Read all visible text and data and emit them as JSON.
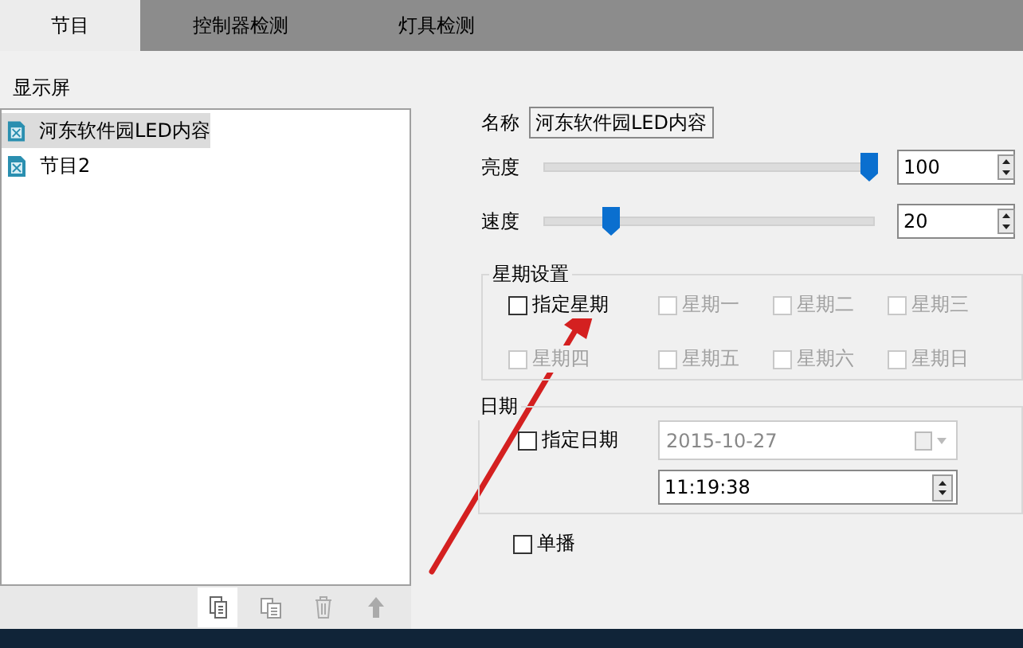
{
  "tabs": [
    {
      "label": "节目",
      "selected": true
    },
    {
      "label": "控制器检测",
      "selected": false
    },
    {
      "label": "灯具检测",
      "selected": false
    }
  ],
  "panel_label": "显示屏",
  "programs": [
    {
      "label": "河东软件园LED内容",
      "selected": true
    },
    {
      "label": "节目2",
      "selected": false
    }
  ],
  "toolbar": [
    {
      "kind": "copy",
      "disabled": false
    },
    {
      "kind": "duplicate",
      "disabled": true
    },
    {
      "kind": "delete",
      "disabled": true
    },
    {
      "kind": "up",
      "disabled": true
    }
  ],
  "name": {
    "label": "名称",
    "value": "河东软件园LED内容"
  },
  "sliders": [
    {
      "label": "亮度",
      "level": 0.98,
      "value": "100"
    },
    {
      "label": "速度",
      "level": 0.2,
      "value": "20"
    }
  ],
  "weekday_group": {
    "title": "星期设置",
    "specify": {
      "label": "指定星期",
      "checked": false
    },
    "days": [
      {
        "label": "星期一",
        "checked": false,
        "disabled": true
      },
      {
        "label": "星期二",
        "checked": false,
        "disabled": true
      },
      {
        "label": "星期三",
        "checked": false,
        "disabled": true
      },
      {
        "label": "星期四",
        "checked": false,
        "disabled": true
      },
      {
        "label": "星期五",
        "checked": false,
        "disabled": true
      },
      {
        "label": "星期六",
        "checked": false,
        "disabled": true
      },
      {
        "label": "星期日",
        "checked": false,
        "disabled": true
      }
    ]
  },
  "date_group": {
    "title": "日期",
    "specify": {
      "label": "指定日期",
      "checked": false
    },
    "date": {
      "value": "2015-10-27",
      "disabled": true
    },
    "time": {
      "value": "11:19:38"
    }
  },
  "single": {
    "label": "单播",
    "checked": false
  }
}
